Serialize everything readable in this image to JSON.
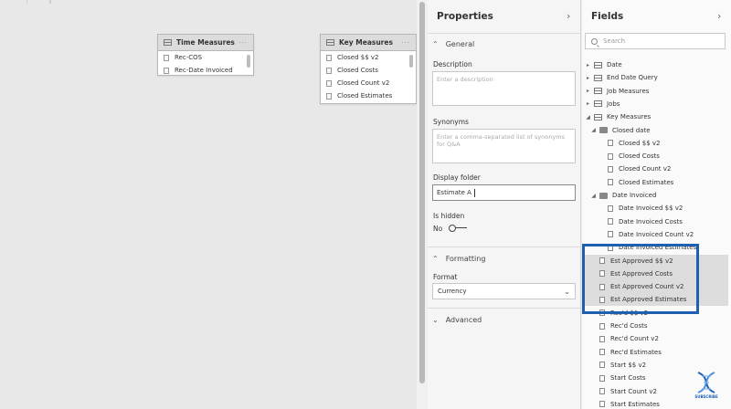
{
  "canvas": {
    "tables": [
      {
        "title": "Time Measures",
        "rows": [
          "Rec-COS",
          "Rec-Date Invoiced"
        ]
      },
      {
        "title": "Key Measures",
        "rows": [
          "Closed $$ v2",
          "Closed Costs",
          "Closed Count v2",
          "Closed Estimates"
        ]
      }
    ]
  },
  "properties": {
    "title": "Properties",
    "general": "General",
    "description_label": "Description",
    "description_placeholder": "Enter a description",
    "synonyms_label": "Synonyms",
    "synonyms_placeholder": "Enter a comma-separated list of synonyms for Q&A",
    "display_folder_label": "Display folder",
    "display_folder_value": "Estimate A",
    "is_hidden_label": "Is hidden",
    "is_hidden_value": "No",
    "formatting": "Formatting",
    "format_label": "Format",
    "format_value": "Currency",
    "advanced": "Advanced"
  },
  "fields": {
    "title": "Fields",
    "search_placeholder": "Search",
    "items": [
      {
        "label": "Date",
        "level": 0,
        "kind": "table"
      },
      {
        "label": "End Date Query",
        "level": 0,
        "kind": "hidden"
      },
      {
        "label": "Job Measures",
        "level": 0,
        "kind": "table"
      },
      {
        "label": "Jobs",
        "level": 0,
        "kind": "table"
      },
      {
        "label": "Key Measures",
        "level": 0,
        "kind": "table",
        "open": true
      },
      {
        "label": "Closed date",
        "level": 1,
        "kind": "folder",
        "open": true
      },
      {
        "label": "Closed $$ v2",
        "level": 2,
        "kind": "measure"
      },
      {
        "label": "Closed Costs",
        "level": 2,
        "kind": "measure"
      },
      {
        "label": "Closed Count v2",
        "level": 2,
        "kind": "measure"
      },
      {
        "label": "Closed Estimates",
        "level": 2,
        "kind": "measure"
      },
      {
        "label": "Date Invoiced",
        "level": 1,
        "kind": "folder",
        "open": true
      },
      {
        "label": "Date Invoiced $$ v2",
        "level": 2,
        "kind": "measure"
      },
      {
        "label": "Date Invoiced Costs",
        "level": 2,
        "kind": "measure"
      },
      {
        "label": "Date Invoiced Count v2",
        "level": 2,
        "kind": "measure"
      },
      {
        "label": "Date Invoiced Estimates",
        "level": 2,
        "kind": "measure"
      },
      {
        "label": "Est Approved $$ v2",
        "level": 1,
        "kind": "measure",
        "selected": true
      },
      {
        "label": "Est Approved Costs",
        "level": 1,
        "kind": "measure",
        "selected": true
      },
      {
        "label": "Est Approved Count v2",
        "level": 1,
        "kind": "measure",
        "selected": true
      },
      {
        "label": "Est Approved Estimates",
        "level": 1,
        "kind": "measure",
        "selected": true
      },
      {
        "label": "Rec'd $$ v2",
        "level": 1,
        "kind": "measure"
      },
      {
        "label": "Rec'd Costs",
        "level": 1,
        "kind": "measure"
      },
      {
        "label": "Rec'd Count v2",
        "level": 1,
        "kind": "measure"
      },
      {
        "label": "Rec'd Estimates",
        "level": 1,
        "kind": "measure"
      },
      {
        "label": "Start $$ v2",
        "level": 1,
        "kind": "measure"
      },
      {
        "label": "Start Costs",
        "level": 1,
        "kind": "measure"
      },
      {
        "label": "Start Count v2",
        "level": 1,
        "kind": "measure"
      },
      {
        "label": "Start Estimates",
        "level": 1,
        "kind": "measure"
      }
    ]
  },
  "watermark": {
    "label": "SUBSCRIBE"
  },
  "colors": {
    "highlight": "#1f5fb0",
    "selected_bg": "#dcdcdc"
  }
}
